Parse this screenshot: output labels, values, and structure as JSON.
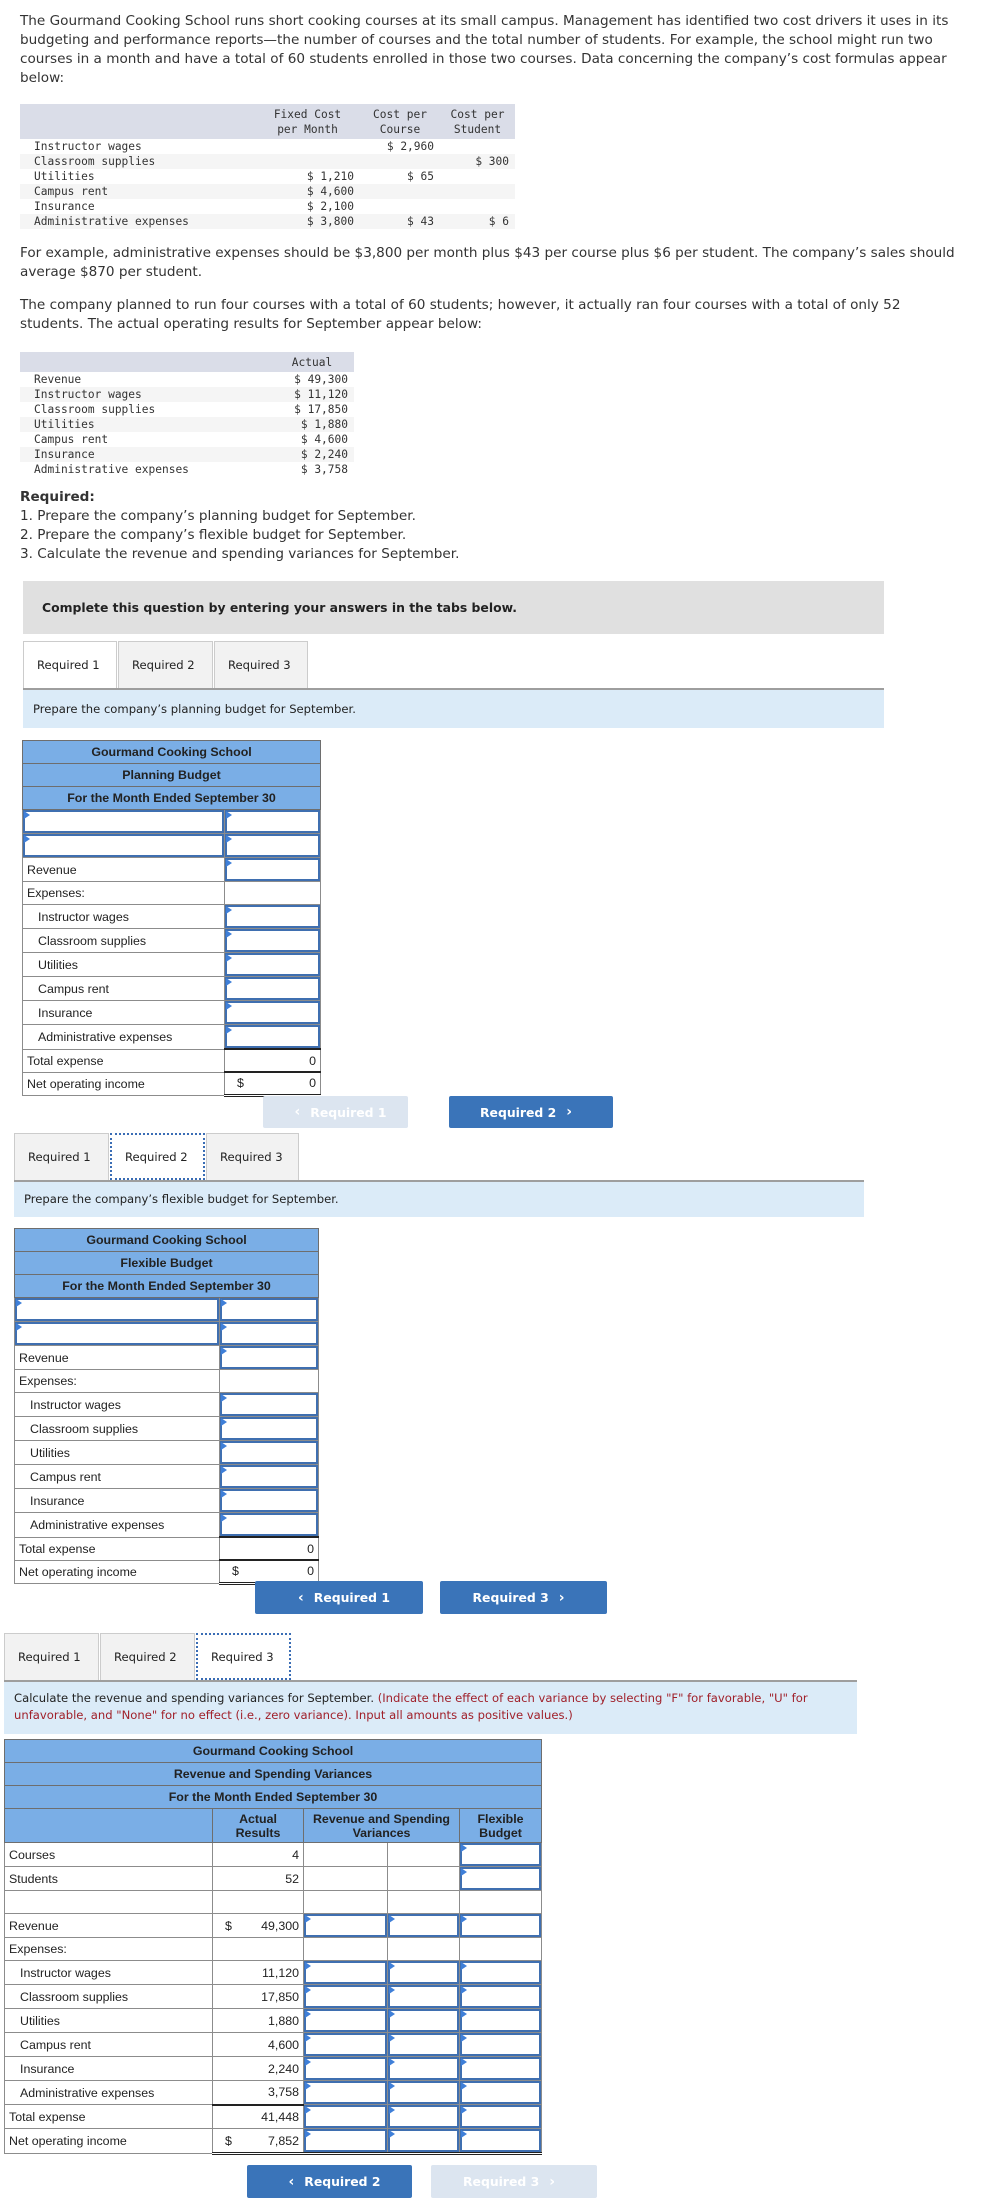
{
  "intro": {
    "p1": "The Gourmand Cooking School runs short cooking courses at its small campus. Management has identified two cost drivers it uses in its budgeting and performance reports—the number of courses and the total number of students. For example, the school might run two courses in a month and have a total of 60 students enrolled in those two courses. Data concerning the company’s cost formulas appear below:",
    "p2": "For example, administrative expenses should be $3,800 per month plus $43 per course plus $6 per student. The company’s sales should average $870 per student.",
    "p3": "The company planned to run four courses with a total of 60 students; however, it actually ran four courses with a total of only 52 students. The actual operating results for September appear below:"
  },
  "cost_table": {
    "headers": [
      "",
      "Fixed Cost\nper Month",
      "Cost per\nCourse",
      "Cost per\nStudent"
    ],
    "header_lines": [
      [
        "Fixed Cost",
        "per Month"
      ],
      [
        "Cost per",
        "Course"
      ],
      [
        "Cost per",
        "Student"
      ]
    ],
    "rows": [
      {
        "label": "Instructor wages",
        "fixed": "",
        "course": "$ 2,960",
        "student": ""
      },
      {
        "label": "Classroom supplies",
        "fixed": "",
        "course": "",
        "student": "$ 300"
      },
      {
        "label": "Utilities",
        "fixed": "$ 1,210",
        "course": "$ 65",
        "student": ""
      },
      {
        "label": "Campus rent",
        "fixed": "$ 4,600",
        "course": "",
        "student": ""
      },
      {
        "label": "Insurance",
        "fixed": "$ 2,100",
        "course": "",
        "student": ""
      },
      {
        "label": "Administrative expenses",
        "fixed": "$ 3,800",
        "course": "$ 43",
        "student": "$ 6"
      }
    ]
  },
  "actual_table": {
    "header": "Actual",
    "rows": [
      {
        "label": "Revenue",
        "value": "$ 49,300"
      },
      {
        "label": "Instructor wages",
        "value": "$ 11,120"
      },
      {
        "label": "Classroom supplies",
        "value": "$ 17,850"
      },
      {
        "label": "Utilities",
        "value": "$ 1,880"
      },
      {
        "label": "Campus rent",
        "value": "$ 4,600"
      },
      {
        "label": "Insurance",
        "value": "$ 2,240"
      },
      {
        "label": "Administrative expenses",
        "value": "$ 3,758"
      }
    ]
  },
  "required": {
    "title": "Required:",
    "items": [
      "1. Prepare the company’s planning budget for September.",
      "2. Prepare the company’s flexible budget for September.",
      "3. Calculate the revenue and spending variances for September."
    ]
  },
  "complete_banner": "Complete this question by entering your answers in the tabs below.",
  "tabs": [
    "Required 1",
    "Required 2",
    "Required 3"
  ],
  "req1": {
    "instruction": "Prepare the company’s planning budget for September.",
    "company": "Gourmand Cooking School",
    "title": "Planning Budget",
    "period": "For the Month Ended September 30",
    "revenue_label": "Revenue",
    "expenses_label": "Expenses:",
    "expense_items": [
      "Instructor wages",
      "Classroom supplies",
      "Utilities",
      "Campus rent",
      "Insurance",
      "Administrative expenses"
    ],
    "total_label": "Total expense",
    "total_value": "0",
    "noi_label": "Net operating income",
    "noi_currency": "$",
    "noi_value": "0",
    "prev_button": "Required 1",
    "next_button": "Required 2"
  },
  "req2": {
    "instruction": "Prepare the company’s flexible budget for September.",
    "company": "Gourmand Cooking School",
    "title": "Flexible Budget",
    "period": "For the Month Ended September 30",
    "revenue_label": "Revenue",
    "expenses_label": "Expenses:",
    "expense_items": [
      "Instructor wages",
      "Classroom supplies",
      "Utilities",
      "Campus rent",
      "Insurance",
      "Administrative expenses"
    ],
    "total_label": "Total expense",
    "total_value": "0",
    "noi_label": "Net operating income",
    "noi_currency": "$",
    "noi_value": "0",
    "prev_button": "Required 1",
    "next_button": "Required 3"
  },
  "req3": {
    "instruction": "Calculate the revenue and spending variances for September.",
    "instruction_note": "(Indicate the effect of each variance by selecting \"F\" for favorable, \"U\" for unfavorable, and \"None\" for no effect (i.e., zero variance). Input all amounts as positive values.)",
    "company": "Gourmand Cooking School",
    "title": "Revenue and Spending Variances",
    "period": "For the Month Ended September 30",
    "col_actual": [
      "Actual",
      "Results"
    ],
    "col_variance": [
      "Revenue and Spending",
      "Variances"
    ],
    "col_flexible": [
      "Flexible",
      "Budget"
    ],
    "courses_label": "Courses",
    "courses_actual": "4",
    "students_label": "Students",
    "students_actual": "52",
    "revenue_label": "Revenue",
    "revenue_currency": "$",
    "revenue_actual": "49,300",
    "expenses_label": "Expenses:",
    "expense_rows": [
      {
        "label": "Instructor wages",
        "actual": "11,120"
      },
      {
        "label": "Classroom supplies",
        "actual": "17,850"
      },
      {
        "label": "Utilities",
        "actual": "1,880"
      },
      {
        "label": "Campus rent",
        "actual": "4,600"
      },
      {
        "label": "Insurance",
        "actual": "2,240"
      },
      {
        "label": "Administrative expenses",
        "actual": "3,758"
      }
    ],
    "total_label": "Total expense",
    "total_actual": "41,448",
    "noi_label": "Net operating income",
    "noi_currency": "$",
    "noi_actual": "7,852",
    "prev_button": "Required 2",
    "next_button": "Required 3"
  }
}
